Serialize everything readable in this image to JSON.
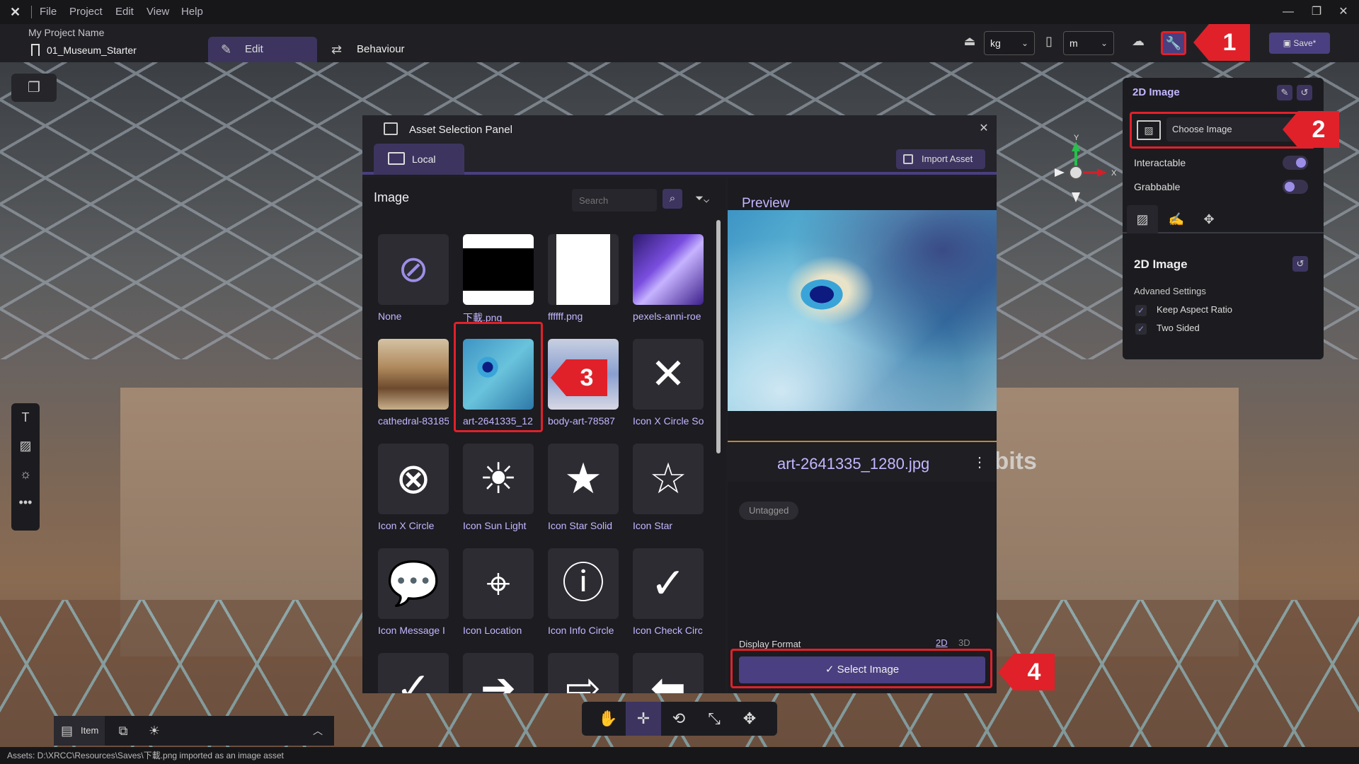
{
  "app": {
    "menu": [
      "File",
      "Project",
      "Edit",
      "View",
      "Help"
    ],
    "project_name": "My Project Name",
    "scene_name": "01_Museum_Starter",
    "modes": [
      "Edit",
      "Behaviour"
    ],
    "mass_unit": "kg",
    "length_unit": "m",
    "save_label": "Save*"
  },
  "viewport": {
    "background_text": "ibits",
    "gizmo_y": "Y",
    "gizmo_x": "X"
  },
  "asset_panel": {
    "title": "Asset Selection Panel",
    "tab_local": "Local",
    "import_label": "Import Asset",
    "section_title": "Image",
    "search_placeholder": "Search",
    "assets": [
      {
        "label": "None",
        "kind": "none"
      },
      {
        "label": "下載.png",
        "kind": "black"
      },
      {
        "label": "ffffff.png",
        "kind": "white"
      },
      {
        "label": "pexels-anni-roe",
        "kind": "purple"
      },
      {
        "label": "cathedral-83185",
        "kind": "cathedral"
      },
      {
        "label": "art-2641335_12",
        "kind": "peacock"
      },
      {
        "label": "body-art-78587",
        "kind": "bodyart"
      },
      {
        "label": "Icon X Circle So",
        "kind": "x-circle-solid"
      },
      {
        "label": "Icon X Circle",
        "kind": "x-circle"
      },
      {
        "label": "Icon Sun Light",
        "kind": "sun"
      },
      {
        "label": "Icon Star Solid",
        "kind": "star-solid"
      },
      {
        "label": "Icon Star",
        "kind": "star"
      },
      {
        "label": "Icon Message I",
        "kind": "message"
      },
      {
        "label": "Icon Location",
        "kind": "location"
      },
      {
        "label": "Icon Info Circle",
        "kind": "info"
      },
      {
        "label": "Icon Check Circ",
        "kind": "check-solid"
      },
      {
        "label": "",
        "kind": "check"
      },
      {
        "label": "",
        "kind": "arrow-right-solid"
      },
      {
        "label": "",
        "kind": "arrow-right"
      },
      {
        "label": "",
        "kind": "arrow-left-solid"
      }
    ],
    "preview_label": "Preview",
    "preview_filename": "art-2641335_1280.jpg",
    "tag": "Untagged",
    "display_format_label": "Display Format",
    "format_2d": "2D",
    "format_3d": "3D",
    "select_label": "Select Image"
  },
  "properties": {
    "title": "2D Image",
    "choose_image_label": "Choose Image",
    "interactable_label": "Interactable",
    "interactable_on": true,
    "grabbable_label": "Grabbable",
    "grabbable_on": true,
    "section_title": "2D Image",
    "advanced_label": "Advaned Settings",
    "keep_aspect_label": "Keep Aspect Ratio",
    "two_sided_label": "Two Sided"
  },
  "bottom": {
    "item_tab": "Item",
    "status": "Assets: D:\\XRCC\\Resources\\Saves\\下載.png imported as an image asset"
  },
  "callouts": [
    "1",
    "2",
    "3",
    "4"
  ],
  "colors": {
    "accent": "#4a3f80",
    "highlight": "#e0212a",
    "label": "#c3b6ff"
  }
}
